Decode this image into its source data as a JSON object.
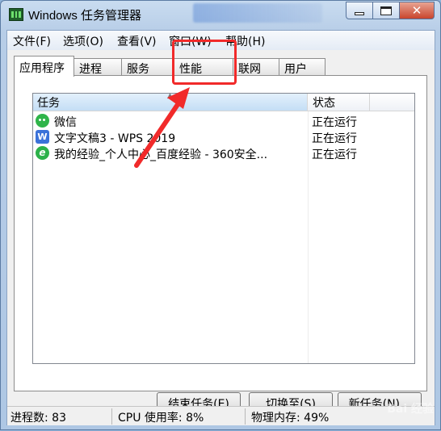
{
  "window": {
    "title": "Windows 任务管理器"
  },
  "menu": [
    "文件(F)",
    "选项(O)",
    "查看(V)",
    "窗口(W)",
    "帮助(H)"
  ],
  "tabs": [
    "应用程序",
    "进程",
    "服务",
    "性能",
    "联网",
    "用户"
  ],
  "table": {
    "columns": [
      "任务",
      "状态"
    ],
    "rows": [
      {
        "task": "微信",
        "status": "正在运行",
        "icon": "wechat-icon"
      },
      {
        "task": "文字文稿3 - WPS 2019",
        "status": "正在运行",
        "icon": "wps-icon"
      },
      {
        "task": "我的经验_个人中心_百度经验 - 360安全...",
        "status": "正在运行",
        "icon": "360-browser-icon"
      }
    ]
  },
  "buttons": {
    "end_task": "结束任务(E)",
    "switch_to": "切换至(S)",
    "new_task": "新任务(N)..."
  },
  "status_bar": {
    "processes": "进程数: 83",
    "cpu": "CPU 使用率: 8%",
    "memory": "物理内存: 49%"
  },
  "watermark": "Bai 经验",
  "annotation": {
    "color": "#f12a2a"
  }
}
